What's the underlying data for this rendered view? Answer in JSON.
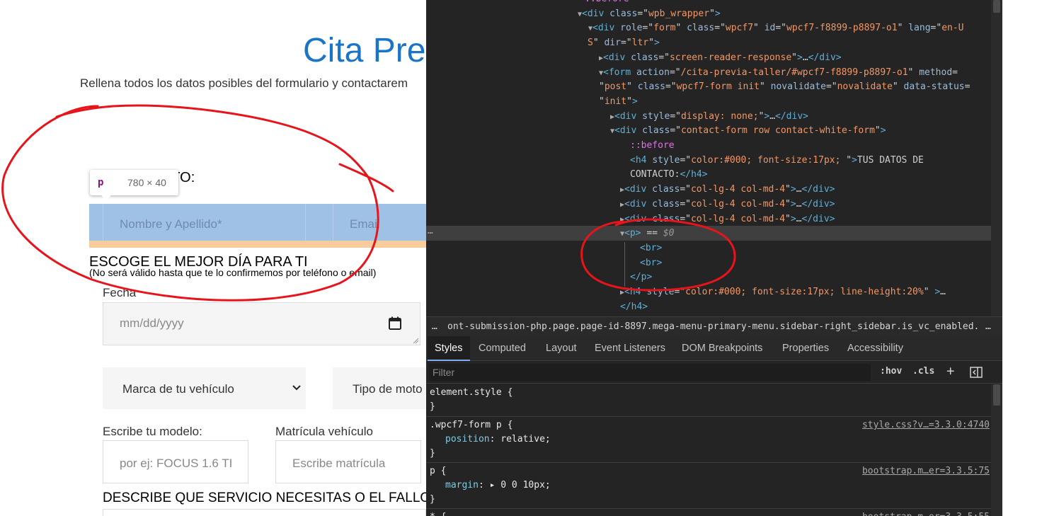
{
  "page": {
    "title": "Cita Pre",
    "intro": "Rellena todos los datos posibles del formulario y contactarem",
    "contact_heading": "DE CONTACTO:",
    "tooltip": {
      "tag": "p",
      "dims": "780 × 40"
    },
    "name_placeholder": "Nombre y Apellido*",
    "email_placeholder": "Email",
    "day_heading": "ESCOGE EL MEJOR DÍA PARA TI",
    "day_note": "(No será válido hasta que te lo confirmemos por teléfono o email)",
    "date_label": "Fecha",
    "date_placeholder": "mm/dd/yyyy",
    "brand_select": "Marca de tu vehículo",
    "engine_select": "Tipo de moto",
    "model_label": "Escribe tu modelo:",
    "model_placeholder": "por ej: FOCUS 1.6 TI",
    "plate_label": "Matrícula vehículo",
    "plate_placeholder": "Escribe matrícula",
    "describe_heading": "DESCRIBE QUE SERVICIO NECESITAS O EL FALLO"
  },
  "devtools": {
    "elements": [
      {
        "indent": 224,
        "tri": "",
        "html": [
          [
            "pe",
            "::before"
          ]
        ],
        "clip": true
      },
      {
        "indent": 214,
        "tri": "▼",
        "html": [
          [
            "tg",
            "<div "
          ],
          [
            "an",
            "class"
          ],
          [
            "tx",
            "=\""
          ],
          [
            "av",
            "wpb_wrapper"
          ],
          [
            "tx",
            "\""
          ],
          [
            "tg",
            ">"
          ]
        ]
      },
      {
        "indent": 229,
        "tri": "▼",
        "html": [
          [
            "tg",
            "<div "
          ],
          [
            "an",
            "role"
          ],
          [
            "tx",
            "=\""
          ],
          [
            "av",
            "form"
          ],
          [
            "tx",
            "\" "
          ],
          [
            "an",
            "class"
          ],
          [
            "tx",
            "=\""
          ],
          [
            "av",
            "wpcf7"
          ],
          [
            "tx",
            "\" "
          ],
          [
            "an",
            "id"
          ],
          [
            "tx",
            "=\""
          ],
          [
            "av",
            "wpcf7-f8899-p8897-o1"
          ],
          [
            "tx",
            "\" "
          ],
          [
            "an",
            "lang"
          ],
          [
            "tx",
            "=\""
          ],
          [
            "av",
            "en-U"
          ]
        ]
      },
      {
        "indent": 228,
        "tri": "",
        "html": [
          [
            "av",
            "S"
          ],
          [
            "tx",
            "\" "
          ],
          [
            "an",
            "dir"
          ],
          [
            "tx",
            "=\""
          ],
          [
            "av",
            "ltr"
          ],
          [
            "tx",
            "\""
          ],
          [
            "tg",
            ">"
          ]
        ]
      },
      {
        "indent": 244,
        "tri": "▶",
        "html": [
          [
            "tg",
            "<div "
          ],
          [
            "an",
            "class"
          ],
          [
            "tx",
            "=\""
          ],
          [
            "av",
            "screen-reader-response"
          ],
          [
            "tx",
            "\""
          ],
          [
            "tg",
            ">"
          ],
          [
            "tx",
            "…"
          ],
          [
            "tg",
            "</div>"
          ]
        ]
      },
      {
        "indent": 244,
        "tri": "▼",
        "html": [
          [
            "tg",
            "<form "
          ],
          [
            "an",
            "action"
          ],
          [
            "tx",
            "=\""
          ],
          [
            "av",
            "/cita-previa-taller/#wpcf7-f8899-p8897-o1"
          ],
          [
            "tx",
            "\" "
          ],
          [
            "an",
            "method"
          ],
          [
            "tx",
            "="
          ]
        ]
      },
      {
        "indent": 244,
        "tri": "",
        "html": [
          [
            "tx",
            "\""
          ],
          [
            "av",
            "post"
          ],
          [
            "tx",
            "\" "
          ],
          [
            "an",
            "class"
          ],
          [
            "tx",
            "=\""
          ],
          [
            "av",
            "wpcf7-form init"
          ],
          [
            "tx",
            "\" "
          ],
          [
            "an",
            "novalidate"
          ],
          [
            "tx",
            "=\""
          ],
          [
            "av",
            "novalidate"
          ],
          [
            "tx",
            "\" "
          ],
          [
            "an",
            "data-status"
          ],
          [
            "tx",
            "="
          ]
        ]
      },
      {
        "indent": 244,
        "tri": "",
        "html": [
          [
            "tx",
            "\""
          ],
          [
            "av",
            "init"
          ],
          [
            "tx",
            "\""
          ],
          [
            "tg",
            ">"
          ]
        ]
      },
      {
        "indent": 260,
        "tri": "▶",
        "html": [
          [
            "tg",
            "<div "
          ],
          [
            "an",
            "style"
          ],
          [
            "tx",
            "=\""
          ],
          [
            "av",
            "display: none;"
          ],
          [
            "tx",
            "\""
          ],
          [
            "tg",
            ">"
          ],
          [
            "tx",
            "…"
          ],
          [
            "tg",
            "</div>"
          ]
        ]
      },
      {
        "indent": 260,
        "tri": "▼",
        "html": [
          [
            "tg",
            "<div "
          ],
          [
            "an",
            "class"
          ],
          [
            "tx",
            "=\""
          ],
          [
            "av",
            "contact-form row contact-white-form"
          ],
          [
            "tx",
            "\""
          ],
          [
            "tg",
            ">"
          ]
        ]
      },
      {
        "indent": 288,
        "tri": "",
        "html": [
          [
            "pe",
            "::before"
          ]
        ]
      },
      {
        "indent": 288,
        "tri": "",
        "html": [
          [
            "tg",
            "<h4 "
          ],
          [
            "an",
            "style"
          ],
          [
            "tx",
            "=\""
          ],
          [
            "av",
            "color:#000; font-size:17px; "
          ],
          [
            "tx",
            "\""
          ],
          [
            "tg",
            ">"
          ],
          [
            "tx",
            "TUS DATOS DE"
          ]
        ]
      },
      {
        "indent": 288,
        "tri": "",
        "html": [
          [
            "tx",
            "CONTACTO:"
          ],
          [
            "tg",
            "</h4>"
          ]
        ]
      },
      {
        "indent": 274,
        "tri": "▶",
        "html": [
          [
            "tg",
            "<div "
          ],
          [
            "an",
            "class"
          ],
          [
            "tx",
            "=\""
          ],
          [
            "av",
            "col-lg-4 col-md-4"
          ],
          [
            "tx",
            "\""
          ],
          [
            "tg",
            ">"
          ],
          [
            "tx",
            "…"
          ],
          [
            "tg",
            "</div>"
          ]
        ]
      },
      {
        "indent": 274,
        "tri": "▶",
        "html": [
          [
            "tg",
            "<div "
          ],
          [
            "an",
            "class"
          ],
          [
            "tx",
            "=\""
          ],
          [
            "av",
            "col-lg-4 col-md-4"
          ],
          [
            "tx",
            "\""
          ],
          [
            "tg",
            ">"
          ],
          [
            "tx",
            "…"
          ],
          [
            "tg",
            "</div>"
          ]
        ]
      },
      {
        "indent": 274,
        "tri": "▶",
        "html": [
          [
            "tg",
            "<div "
          ],
          [
            "an",
            "class"
          ],
          [
            "tx",
            "=\""
          ],
          [
            "av",
            "col-lg-4 col-md-4"
          ],
          [
            "tx",
            "\""
          ],
          [
            "tg",
            ">"
          ],
          [
            "tx",
            "…"
          ],
          [
            "tg",
            "</div>"
          ]
        ]
      },
      {
        "indent": 274,
        "tri": "▼",
        "sel": true,
        "html": [
          [
            "tg",
            "<p>"
          ],
          [
            "tx",
            " == "
          ],
          [
            "dollar",
            "$0"
          ]
        ]
      },
      {
        "indent": 302,
        "tri": "",
        "html": [
          [
            "tg",
            "<br>"
          ]
        ]
      },
      {
        "indent": 302,
        "tri": "",
        "html": [
          [
            "tg",
            "<br>"
          ]
        ]
      },
      {
        "indent": 288,
        "tri": "",
        "html": [
          [
            "tg",
            "</p>"
          ]
        ]
      },
      {
        "indent": 274,
        "tri": "▶",
        "html": [
          [
            "tg",
            "<h4 "
          ],
          [
            "an",
            "style"
          ],
          [
            "tx",
            "=\""
          ],
          [
            "av",
            "color:#000; font-size:17px; line-height:20%"
          ],
          [
            "tx",
            "\" "
          ],
          [
            "tg",
            ">"
          ],
          [
            "tx",
            "…"
          ]
        ]
      },
      {
        "indent": 274,
        "tri": "",
        "html": [
          [
            "tg",
            "</h4>"
          ]
        ]
      }
    ],
    "breadcrumb": "ont-submission-php.page.page-id-8897.mega-menu-primary-menu.sidebar-right_sidebar.is_vc_enabled.site-layou",
    "breadcrumb_dots": "…",
    "tabs": [
      "Styles",
      "Computed",
      "Layout",
      "Event Listeners",
      "DOM Breakpoints",
      "Properties",
      "Accessibility"
    ],
    "filter_placeholder": "Filter",
    "hov_label": ":hov",
    "cls_label": ".cls",
    "plus_label": "+",
    "rules": [
      {
        "selector": "element.style {",
        "decls": [],
        "close": "}",
        "src": ""
      },
      {
        "selector": ".wpcf7-form p {",
        "decls": [
          {
            "p": "position",
            "v": "relative;"
          }
        ],
        "close": "}",
        "src": "style.css?v…=3.3.0:4740"
      },
      {
        "selector": "p {",
        "decls": [
          {
            "p": "margin",
            "v": "0 0 10px;",
            "tri": true
          }
        ],
        "close": "}",
        "src": "bootstrap.m…er=3.3.5:75"
      },
      {
        "selector": "* {",
        "decls": [],
        "close": "",
        "src": "bootstrap.m…er=3.3.5:55"
      }
    ]
  },
  "colors": {
    "accent": "#1a74c7",
    "annotation": "#e8141b",
    "highlight": "#9fc1e6",
    "padding": "#f6cc9c"
  }
}
